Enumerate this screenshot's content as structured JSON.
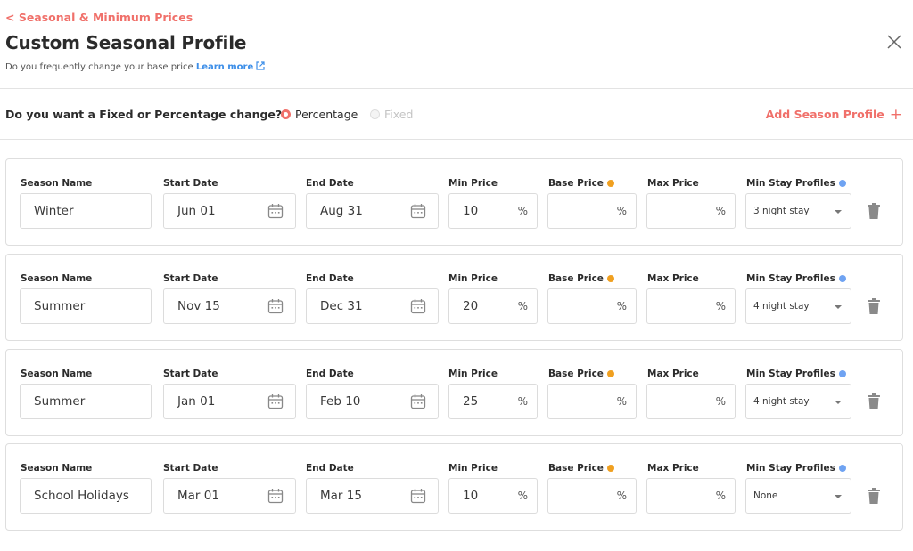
{
  "header": {
    "back_label": "< Seasonal & Minimum Prices",
    "title": "Custom Seasonal Profile",
    "subtitle": "Do you frequently change your base price",
    "learn_more": "Learn more"
  },
  "change_type": {
    "question": "Do you want a Fixed or Percentage change?:",
    "options": [
      {
        "label": "Percentage",
        "selected": true
      },
      {
        "label": "Fixed",
        "selected": false
      }
    ]
  },
  "add_profile_label": "Add Season Profile",
  "labels": {
    "season_name": "Season Name",
    "start_date": "Start Date",
    "end_date": "End Date",
    "min_price": "Min Price",
    "base_price": "Base Price",
    "max_price": "Max Price",
    "min_stay": "Min Stay Profiles",
    "percent": "%"
  },
  "colors": {
    "accent": "#f0706a",
    "link": "#3c8ee8",
    "base_price_indicator": "#f0a020",
    "min_stay_indicator": "#6fa3f2"
  },
  "seasons": [
    {
      "name": "Winter",
      "start": "Jun 01",
      "end": "Aug 31",
      "min_price": "10",
      "base_price": "",
      "max_price": "",
      "min_stay": "3 night stay"
    },
    {
      "name": "Summer",
      "start": "Nov 15",
      "end": "Dec 31",
      "min_price": "20",
      "base_price": "",
      "max_price": "",
      "min_stay": "4 night stay"
    },
    {
      "name": "Summer",
      "start": "Jan 01",
      "end": "Feb 10",
      "min_price": "25",
      "base_price": "",
      "max_price": "",
      "min_stay": "4 night stay"
    },
    {
      "name": "School Holidays",
      "start": "Mar 01",
      "end": "Mar 15",
      "min_price": "10",
      "base_price": "",
      "max_price": "",
      "min_stay": "None"
    }
  ]
}
